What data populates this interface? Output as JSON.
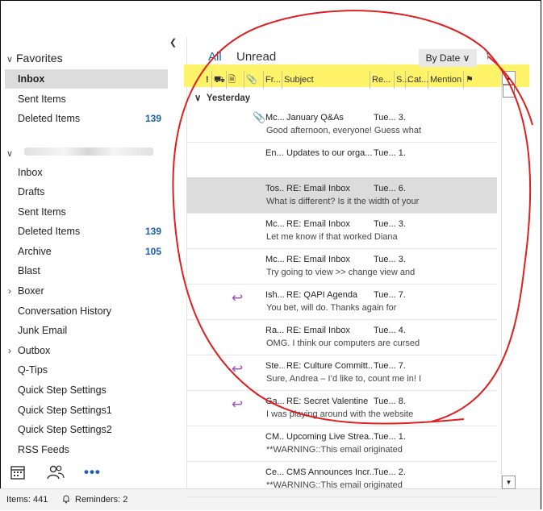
{
  "sidebar": {
    "favorites_header": "Favorites",
    "favorites": [
      {
        "label": "Inbox",
        "count": ""
      },
      {
        "label": "Sent Items",
        "count": ""
      },
      {
        "label": "Deleted Items",
        "count": "139"
      }
    ],
    "folders": [
      {
        "label": "Inbox",
        "count": ""
      },
      {
        "label": "Drafts",
        "count": ""
      },
      {
        "label": "Sent Items",
        "count": ""
      },
      {
        "label": "Deleted Items",
        "count": "139"
      },
      {
        "label": "Archive",
        "count": "105"
      },
      {
        "label": "Blast",
        "count": ""
      },
      {
        "label": "Boxer",
        "count": ""
      },
      {
        "label": "Conversation History",
        "count": ""
      },
      {
        "label": "Junk Email",
        "count": ""
      },
      {
        "label": "Outbox",
        "count": ""
      },
      {
        "label": "Q-Tips",
        "count": ""
      },
      {
        "label": "Quick Step Settings",
        "count": ""
      },
      {
        "label": "Quick Step Settings1",
        "count": ""
      },
      {
        "label": "Quick Step Settings2",
        "count": ""
      },
      {
        "label": "RSS Feeds",
        "count": ""
      }
    ],
    "bottom_icons": [
      "calendar-icon",
      "people-icon",
      "more-icon"
    ]
  },
  "status": {
    "items": "Items: 441",
    "reminders": "Reminders: 2"
  },
  "mail": {
    "tab_all": "All",
    "tab_unread": "Unread",
    "sort_label": "By Date",
    "columns": {
      "importance": "!",
      "reminder": "",
      "icon": "",
      "attachment": "",
      "from": "Fr...",
      "subject": "Subject",
      "received": "Re...",
      "size": "S...",
      "category": "Cat...",
      "mention": "Mention",
      "flag": ""
    },
    "group_label": "Yesterday",
    "rows": [
      {
        "from": "Mc...",
        "subject": "January Q&As",
        "date": "Tue... 3..",
        "preview": "Good afternoon, everyone!  Guess what",
        "icon": "clip"
      },
      {
        "from": "En...",
        "subject": "Updates to our orga...",
        "date": "Tue... 1..",
        "preview": "",
        "icon": ""
      },
      {
        "from": "Tos...",
        "subject": "RE: Email Inbox",
        "date": "Tue... 6..",
        "preview": "What is different?    Is it the width of your",
        "icon": ""
      },
      {
        "from": "Mc...",
        "subject": "RE: Email Inbox",
        "date": "Tue... 3..",
        "preview": "Let me know if that worked  Diana",
        "icon": ""
      },
      {
        "from": "Mc...",
        "subject": "RE: Email Inbox",
        "date": "Tue... 3..",
        "preview": "Try going to view >> change view and",
        "icon": ""
      },
      {
        "from": "Ish...",
        "subject": "RE: QAPI Agenda",
        "date": "Tue... 7..",
        "preview": "You bet, will do.  Thanks again for",
        "icon": "reply"
      },
      {
        "from": "Ra...",
        "subject": "RE: Email Inbox",
        "date": "Tue... 4..",
        "preview": "OMG. I think our computers are cursed",
        "icon": ""
      },
      {
        "from": "Ste...",
        "subject": "RE: Culture Committ...",
        "date": "Tue... 7..",
        "preview": "Sure, Andrea – I’d like to, count me in!  I",
        "icon": "reply"
      },
      {
        "from": "Ga...",
        "subject": "RE: Secret Valentine",
        "date": "Tue... 8..",
        "preview": "I was playing around with the website",
        "icon": "reply"
      },
      {
        "from": "CM...",
        "subject": "Upcoming Live Strea...",
        "date": "Tue... 1..",
        "preview": "**WARNING::This email originated",
        "icon": ""
      },
      {
        "from": "Ce...",
        "subject": "CMS Announces Incr...",
        "date": "Tue... 2..",
        "preview": "**WARNING::This email originated",
        "icon": ""
      }
    ]
  },
  "annotation_color": "#e02020",
  "highlight_color": "#fff36a"
}
